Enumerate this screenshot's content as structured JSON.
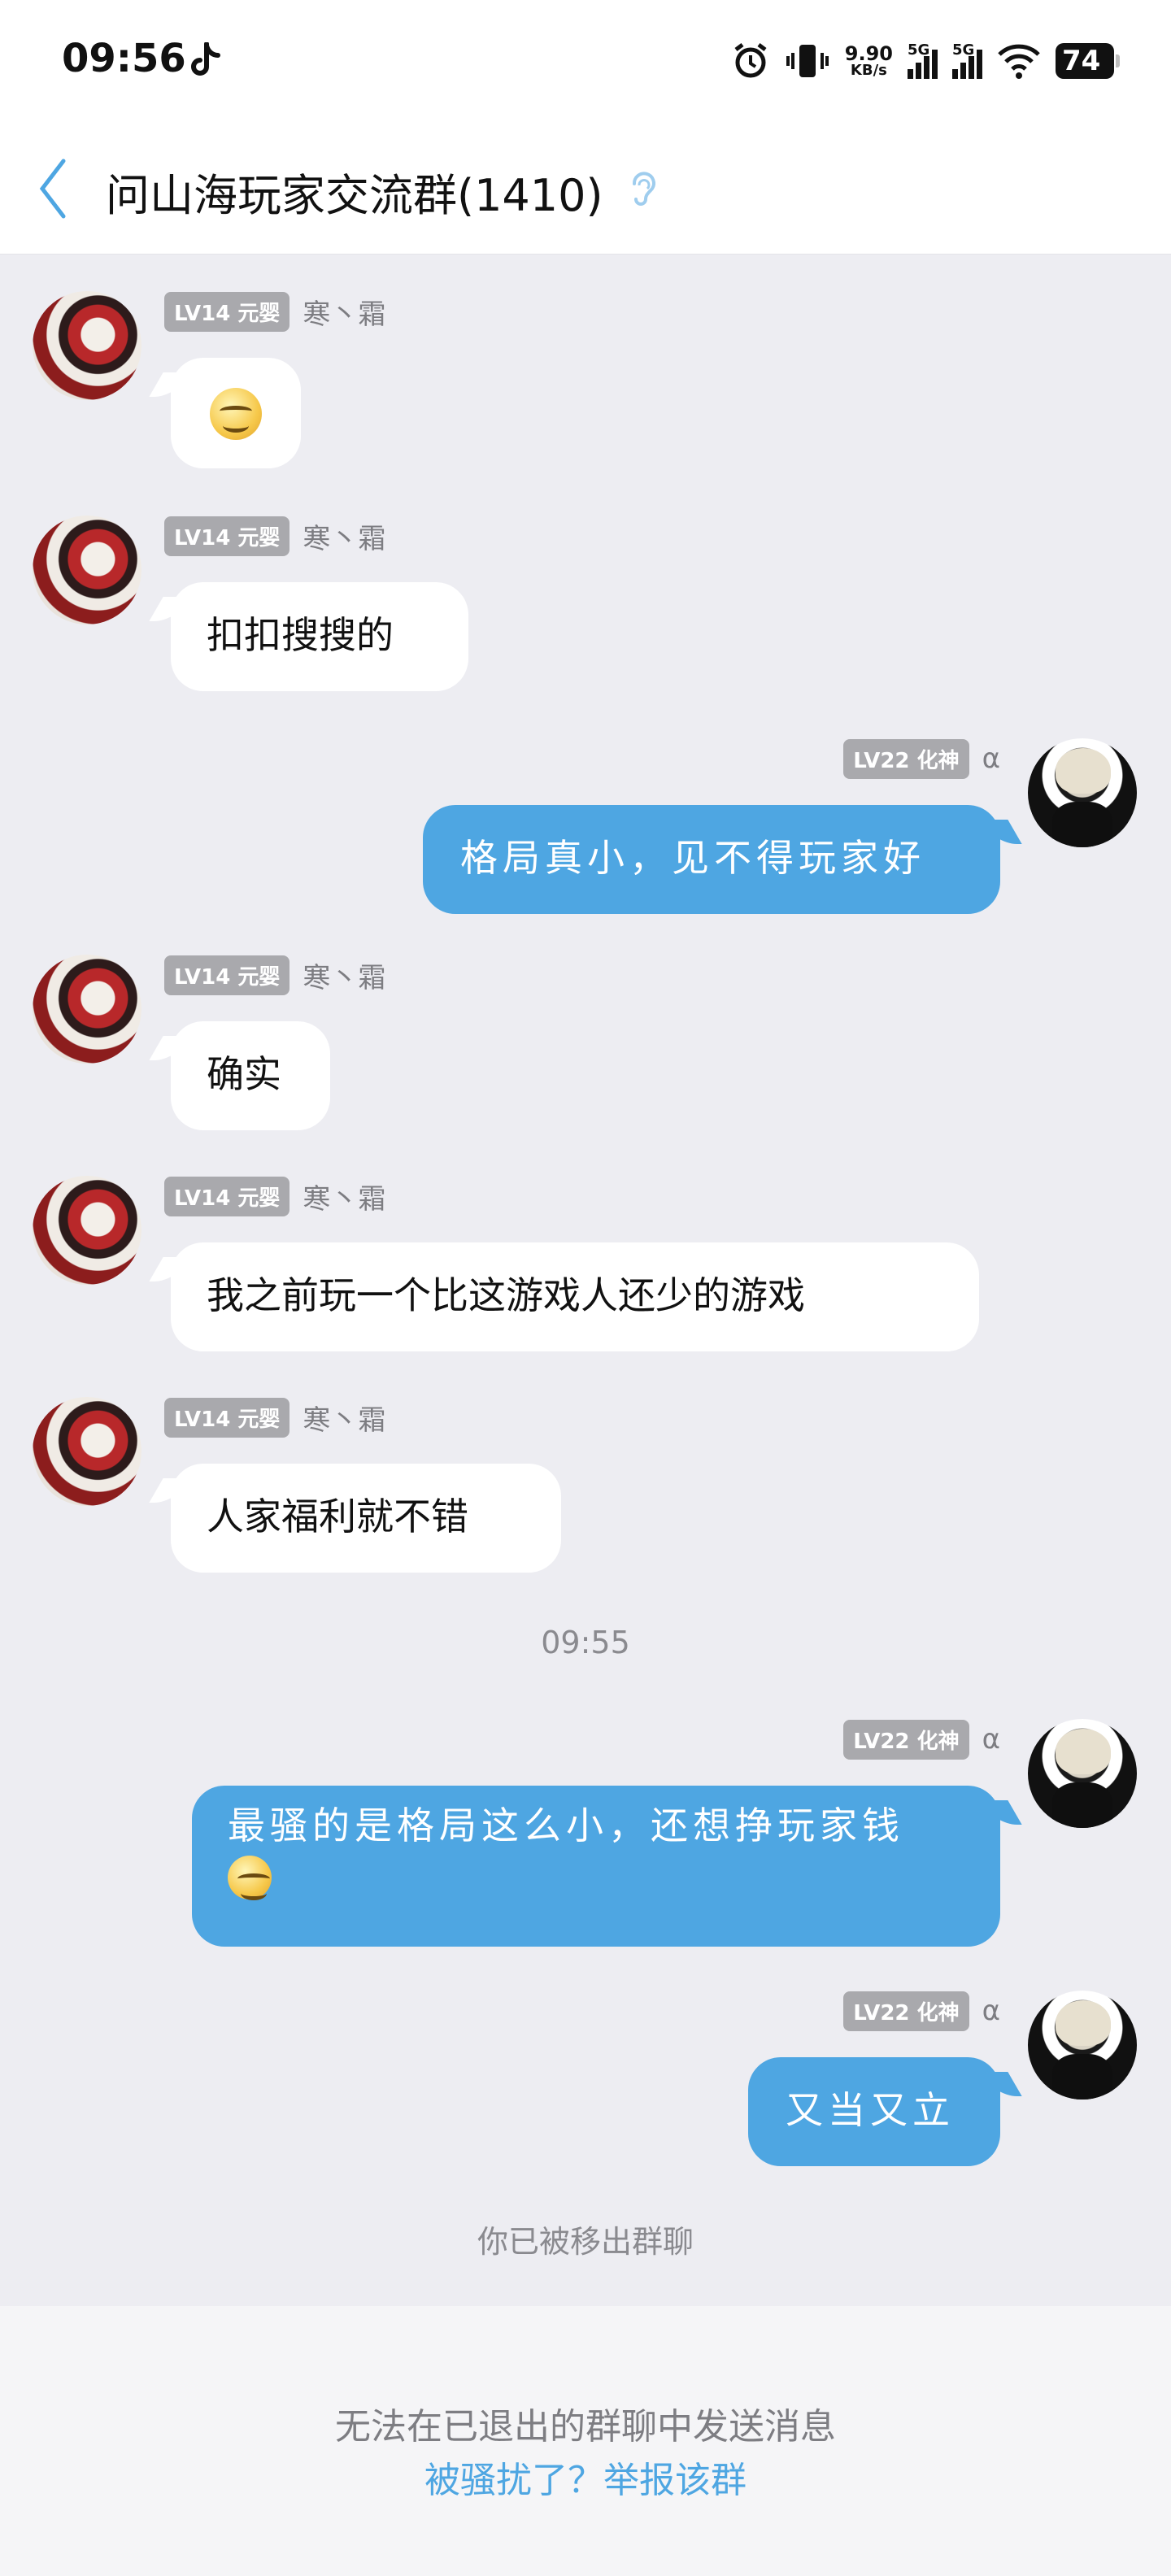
{
  "status_bar": {
    "time": "09:56",
    "net_speed_value": "9.90",
    "net_speed_unit": "KB/s",
    "signal1_label": "5G",
    "signal2_label": "5G",
    "battery": "74",
    "icons": [
      "tiktok-icon",
      "alarm-icon",
      "vibrate-icon",
      "signal-icon",
      "signal-icon",
      "wifi-icon",
      "battery-icon"
    ]
  },
  "header": {
    "title": "问山海玩家交流群(1410)",
    "accent_color": "#4ea6e2"
  },
  "messages": [
    {
      "side": "left",
      "badge": "LV14 元婴",
      "nick": "寒丶霜",
      "text": "",
      "emoji": "smirk-emoji"
    },
    {
      "side": "left",
      "badge": "LV14 元婴",
      "nick": "寒丶霜",
      "text": "扣扣搜搜的"
    },
    {
      "side": "right",
      "badge": "LV22 化神",
      "nick": "α",
      "text": "格局真小，见不得玩家好"
    },
    {
      "side": "left",
      "badge": "LV14 元婴",
      "nick": "寒丶霜",
      "text": "确实"
    },
    {
      "side": "left",
      "badge": "LV14 元婴",
      "nick": "寒丶霜",
      "text": "我之前玩一个比这游戏人还少的游戏"
    },
    {
      "side": "left",
      "badge": "LV14 元婴",
      "nick": "寒丶霜",
      "text": "人家福利就不错"
    },
    {
      "side": "right",
      "badge": "LV22 化神",
      "nick": "α",
      "text": "最骚的是格局这么小，还想挣玩家钱",
      "emoji": "smirk-emoji"
    },
    {
      "side": "right",
      "badge": "LV22 化神",
      "nick": "α",
      "text": "又当又立"
    }
  ],
  "timestamp": "09:55",
  "system_note": "你已被移出群聊",
  "footer": {
    "notice": "无法在已退出的群聊中发送消息",
    "report_link": "被骚扰了？举报该群"
  }
}
